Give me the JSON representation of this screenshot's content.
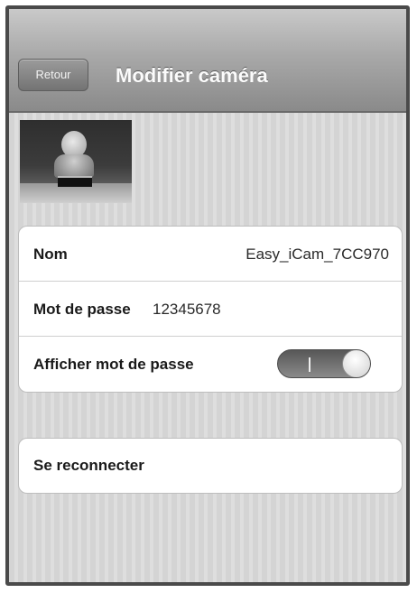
{
  "navbar": {
    "back_label": "Retour",
    "title": "Modifier caméra"
  },
  "camera": {
    "thumbnail": "camera-preview-image"
  },
  "settings": {
    "name_label": "Nom",
    "name_value": "Easy_iCam_7CC970",
    "password_label": "Mot de passe",
    "password_value": "12345678",
    "show_password_label": "Afficher mot de passe",
    "show_password_on": true
  },
  "actions": {
    "reconnect_label": "Se reconnecter"
  }
}
